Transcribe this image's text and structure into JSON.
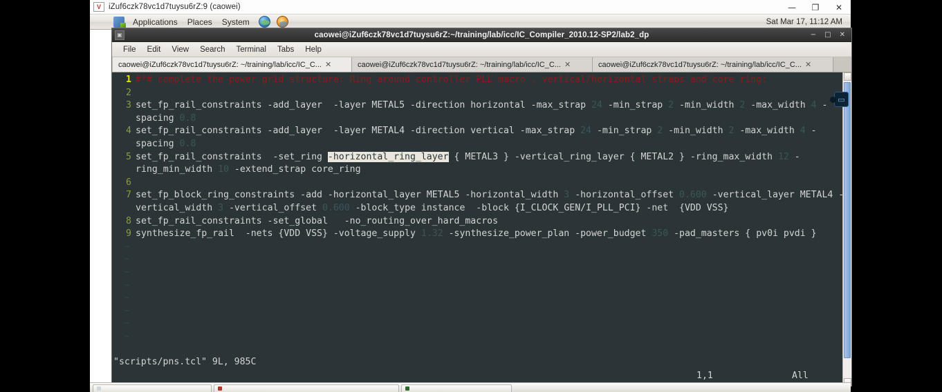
{
  "vnc_window": {
    "icon": "vnc-icon",
    "icon_text": "V",
    "title": "iZuf6czk78vc1d7tuysu6rZ:9 (caowei)",
    "buttons": {
      "minimize": "—",
      "maximize": "❐",
      "close": "✕"
    }
  },
  "gnome_panel": {
    "menus": [
      "Applications",
      "Places",
      "System"
    ],
    "launchers": [
      "globe-icon",
      "help-icon"
    ],
    "clock": "Sat Mar 17, 11:12 AM"
  },
  "terminal": {
    "title": "caowei@iZuf6czk78vc1d7tuysu6rZ:~/training/lab/icc/IC_Compiler_2010.12-SP2/lab2_dp",
    "titlebar_buttons": {
      "minimize": "−",
      "maximize": "□",
      "close": "✕"
    },
    "menus": [
      "File",
      "Edit",
      "View",
      "Search",
      "Terminal",
      "Tabs",
      "Help"
    ],
    "tabs": [
      {
        "label": "caowei@iZuf6czk78vc1d7tuysu6rZ: ~/training/lab/icc/IC_C...",
        "close": "✕",
        "active": true
      },
      {
        "label": "caowei@iZuf6czk78vc1d7tuysu6rZ: ~/training/lab/icc/IC_C...",
        "close": "✕",
        "active": false
      },
      {
        "label": "caowei@iZuf6czk78vc1d7tuysu6rZ: ~/training/lab/icc/IC_C...",
        "close": "✕",
        "active": false
      }
    ]
  },
  "editor": {
    "lines": [
      {
        "num": "1",
        "current": true,
        "segments": [
          {
            "text": "#*# complete the power grid structure: Ring around controller PLL macro , vertical/horizontal straps and core ring:",
            "style": "comment"
          }
        ]
      },
      {
        "num": "2",
        "current": false,
        "segments": [
          {
            "text": "",
            "style": "plain"
          }
        ]
      },
      {
        "num": "3",
        "current": false,
        "segments": [
          {
            "text": "set_fp_rail_constraints -add_layer  -layer METAL5 -direction horizontal -max_strap ",
            "style": "plain"
          },
          {
            "text": "24",
            "style": "number"
          },
          {
            "text": " -min_strap ",
            "style": "plain"
          },
          {
            "text": "2",
            "style": "number"
          },
          {
            "text": " -min_width ",
            "style": "plain"
          },
          {
            "text": "2",
            "style": "number"
          },
          {
            "text": " -max_width ",
            "style": "plain"
          },
          {
            "text": "4",
            "style": "number"
          },
          {
            "text": " -spacing ",
            "style": "plain"
          },
          {
            "text": "0.8",
            "style": "number"
          }
        ]
      },
      {
        "num": "4",
        "current": false,
        "segments": [
          {
            "text": "set_fp_rail_constraints -add_layer  -layer METAL4 -direction vertical -max_strap ",
            "style": "plain"
          },
          {
            "text": "24",
            "style": "number"
          },
          {
            "text": " -min_strap ",
            "style": "plain"
          },
          {
            "text": "2",
            "style": "number"
          },
          {
            "text": " -min_width ",
            "style": "plain"
          },
          {
            "text": "2",
            "style": "number"
          },
          {
            "text": " -max_width ",
            "style": "plain"
          },
          {
            "text": "4",
            "style": "number"
          },
          {
            "text": " -spacing ",
            "style": "plain"
          },
          {
            "text": "0.8",
            "style": "number"
          }
        ]
      },
      {
        "num": "5",
        "current": false,
        "segments": [
          {
            "text": "set_fp_rail_constraints  -set_ring ",
            "style": "plain"
          },
          {
            "text": "-horizontal_ring_layer",
            "style": "highlight"
          },
          {
            "text": " { METAL3 } -vertical_ring_layer { METAL2 } -ring_max_width ",
            "style": "plain"
          },
          {
            "text": "12",
            "style": "number"
          },
          {
            "text": " -ring_min_width ",
            "style": "plain"
          },
          {
            "text": "10",
            "style": "number"
          },
          {
            "text": " -extend_strap core_ring",
            "style": "plain"
          }
        ]
      },
      {
        "num": "6",
        "current": false,
        "segments": [
          {
            "text": "",
            "style": "plain"
          }
        ]
      },
      {
        "num": "7",
        "current": false,
        "segments": [
          {
            "text": "set_fp_block_ring_constraints -add -horizontal_layer METAL5 -horizontal_width ",
            "style": "plain"
          },
          {
            "text": "3",
            "style": "number"
          },
          {
            "text": " -horizontal_offset ",
            "style": "plain"
          },
          {
            "text": "0.600",
            "style": "number"
          },
          {
            "text": " -vertical_layer METAL4 -vertical_width ",
            "style": "plain"
          },
          {
            "text": "3",
            "style": "number"
          },
          {
            "text": " -vertical_offset ",
            "style": "plain"
          },
          {
            "text": "0.600",
            "style": "number"
          },
          {
            "text": " -block_type instance  -block {I_CLOCK_GEN/I_PLL_PCI} -net  {VDD VSS}",
            "style": "plain"
          }
        ]
      },
      {
        "num": "8",
        "current": false,
        "segments": [
          {
            "text": "set_fp_rail_constraints -set_global   -no_routing_over_hard_macros",
            "style": "plain"
          }
        ]
      },
      {
        "num": "9",
        "current": false,
        "segments": [
          {
            "text": "synthesize_fp_rail  -nets {VDD VSS} -voltage_supply ",
            "style": "plain"
          },
          {
            "text": "1.32",
            "style": "number"
          },
          {
            "text": " -synthesize_power_plan -power_budget ",
            "style": "plain"
          },
          {
            "text": "350",
            "style": "number"
          },
          {
            "text": " -pad_masters { pv0i pvdi }",
            "style": "plain"
          }
        ]
      }
    ],
    "tilde": "~",
    "status": {
      "file_info": "\"scripts/pns.tcl\" 9L, 985C",
      "cursor_position": "1,1",
      "scroll_indicator": "All"
    }
  },
  "desktop_taskbar": {
    "items": [
      {
        "label": "",
        "color": "#cfd6dc"
      },
      {
        "label": "",
        "color": "#b03a2e"
      },
      {
        "label": "",
        "color": "#2d6a2d"
      }
    ]
  },
  "floating_icon": {
    "name": "remote-display-icon",
    "glyph": "▭"
  },
  "colors": {
    "terminal_bg": "#2b3538",
    "comment": "#8b1a1a",
    "number": "#3c5558",
    "linenumber": "#8f9a43",
    "highlight_bg": "#e9e7dd"
  }
}
